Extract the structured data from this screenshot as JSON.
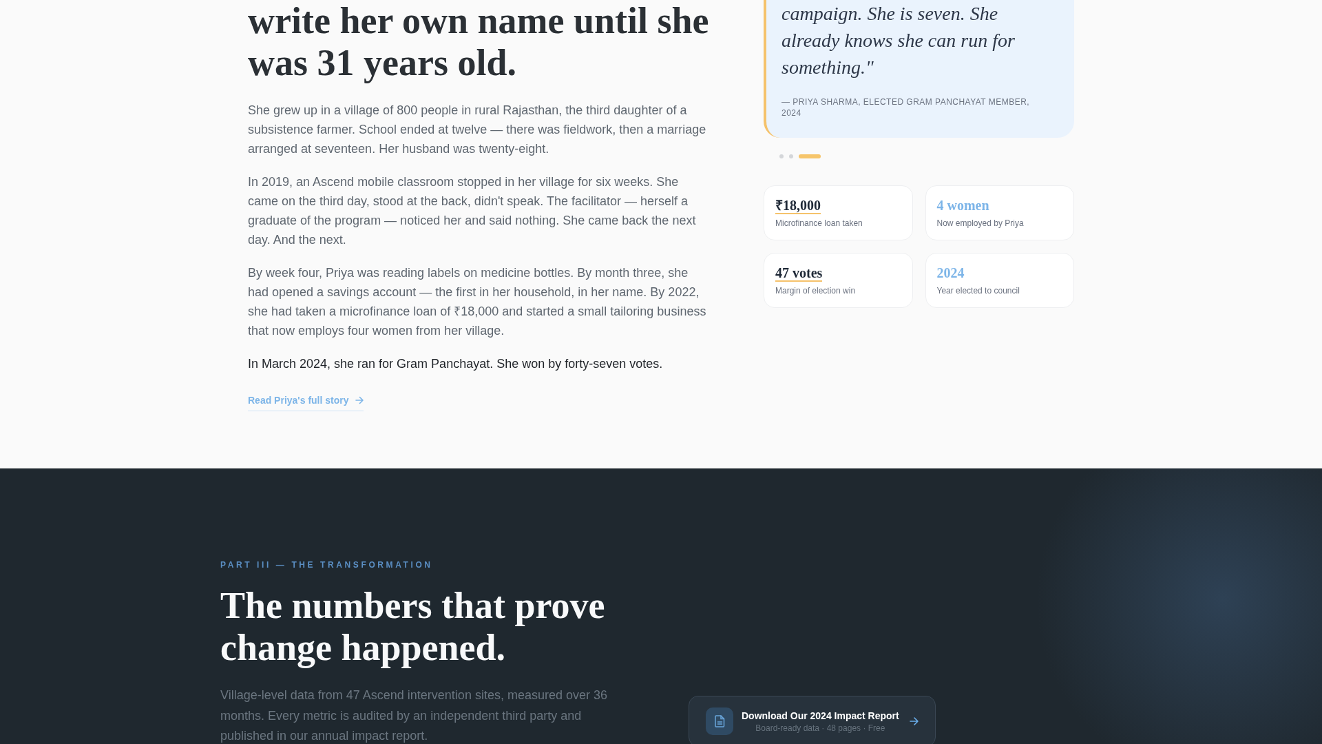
{
  "story": {
    "heading": "write her own name until she was 31 years old.",
    "paragraphs": [
      {
        "kind": "body",
        "text": "She grew up in a village of 800 people in rural Rajasthan, the third daughter of a subsistence farmer. School ended at twelve — there was fieldwork, then a marriage arranged at seventeen. Her husband was twenty-eight."
      },
      {
        "kind": "body",
        "text": "In 2019, an Ascend mobile classroom stopped in her village for six weeks. She came on the third day, stood at the back, didn't speak. The facilitator — herself a graduate of the program — noticed her and said nothing. She came back the next day. And the next."
      },
      {
        "kind": "body",
        "text": "By week four, Priya was reading labels on medicine bottles. By month three, she had opened a savings account — the first in her household, in her name. By 2022, she had taken a microfinance loan of ₹18,000 and started a small tailoring business that now employs four women from her village."
      },
      {
        "kind": "emphasis",
        "text": "In March 2024, she ran for Gram Panchayat. She won by forty-seven votes."
      }
    ],
    "link": {
      "label": "Read Priya's full story"
    }
  },
  "quote_card": {
    "quote": "campaign. She is seven. She already knows she can run for something.\"",
    "attribution": "— PRIYA SHARMA, ELECTED GRAM PANCHAYAT MEMBER, 2024"
  },
  "carousel_dots": [
    {
      "selected": false
    },
    {
      "selected": false
    },
    {
      "selected": true
    }
  ],
  "stats": [
    {
      "kind": "underlined",
      "value": "₹18,000",
      "label": "Microfinance loan taken"
    },
    {
      "kind": "accent",
      "value": "4 women",
      "label": "Now employed by Priya"
    },
    {
      "kind": "underlined",
      "value": "47 votes",
      "label": "Margin of election win"
    },
    {
      "kind": "accent",
      "value": "2024",
      "label": "Year elected to council"
    }
  ],
  "transformation": {
    "eyebrow": "PART III — THE TRANSFORMATION",
    "heading": "The numbers that prove change happened.",
    "intro": "Village-level data from 47 Ascend intervention sites, measured over 36 months. Every metric is audited by an independent third party and published in our annual impact report.",
    "download_button": {
      "title": "Download Our 2024 Impact Report",
      "subtitle": "Board-ready data · 48 pages · Free"
    }
  }
}
